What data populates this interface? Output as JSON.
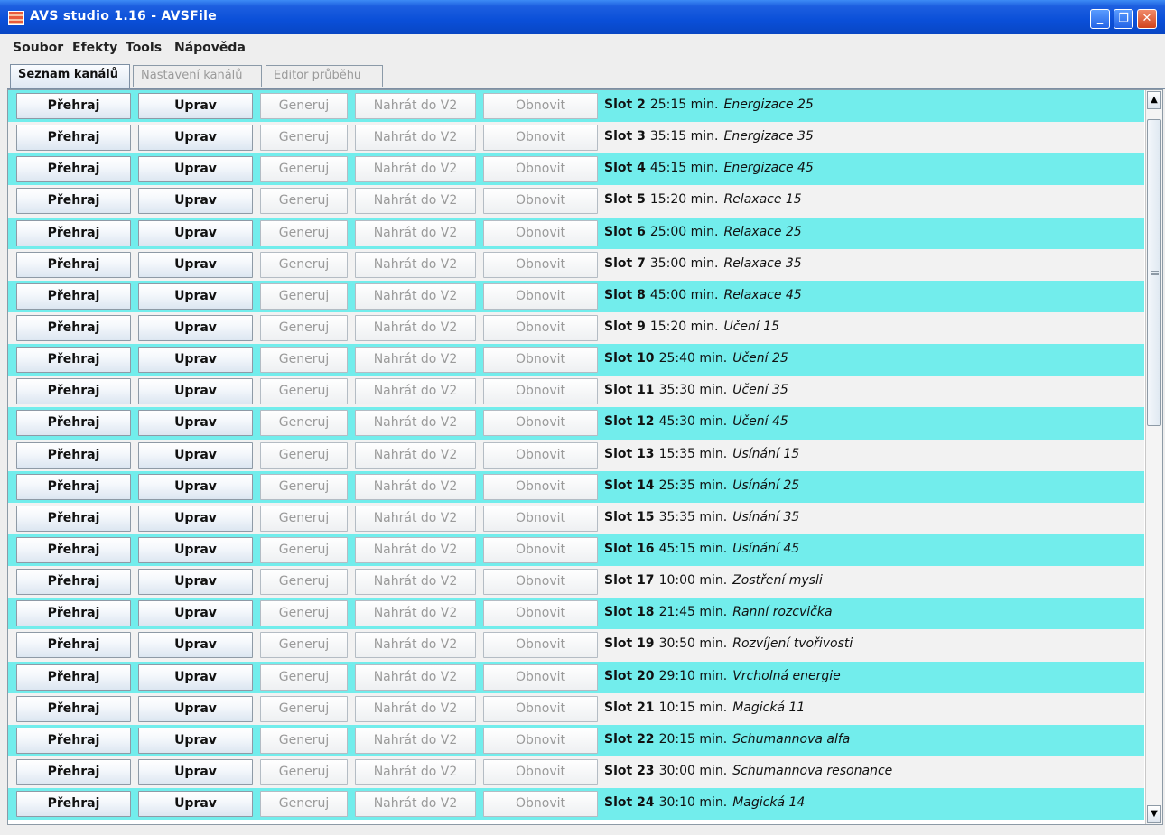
{
  "window": {
    "title": "AVS studio 1.16 - AVSFile",
    "minimize_glyph": "_",
    "maximize_glyph": "❐",
    "close_glyph": "✕"
  },
  "menu": [
    "Soubor",
    "Efekty",
    "Tools",
    "Nápověda"
  ],
  "tabs": [
    {
      "label": "Seznam kanálů",
      "active": true
    },
    {
      "label": "Nastavení kanálů",
      "active": false
    },
    {
      "label": "Editor průběhu",
      "active": false
    }
  ],
  "buttons": {
    "play": "Přehraj",
    "edit": "Uprav",
    "generate": "Generuj",
    "upload": "Nahrát do V2",
    "refresh": "Obnovit"
  },
  "rows": [
    {
      "slot": "Slot 2",
      "duration": "25:15 min.",
      "name": "Energizace 25"
    },
    {
      "slot": "Slot 3",
      "duration": "35:15 min.",
      "name": "Energizace 35"
    },
    {
      "slot": "Slot 4",
      "duration": "45:15 min.",
      "name": "Energizace 45"
    },
    {
      "slot": "Slot 5",
      "duration": "15:20 min.",
      "name": "Relaxace 15"
    },
    {
      "slot": "Slot 6",
      "duration": "25:00 min.",
      "name": "Relaxace 25"
    },
    {
      "slot": "Slot 7",
      "duration": "35:00 min.",
      "name": "Relaxace 35"
    },
    {
      "slot": "Slot 8",
      "duration": "45:00 min.",
      "name": "Relaxace 45"
    },
    {
      "slot": "Slot 9",
      "duration": "15:20 min.",
      "name": "Učení 15"
    },
    {
      "slot": "Slot 10",
      "duration": "25:40 min.",
      "name": "Učení 25"
    },
    {
      "slot": "Slot 11",
      "duration": "35:30 min.",
      "name": "Učení 35"
    },
    {
      "slot": "Slot 12",
      "duration": "45:30 min.",
      "name": "Učení 45"
    },
    {
      "slot": "Slot 13",
      "duration": "15:35 min.",
      "name": "Usínání 15"
    },
    {
      "slot": "Slot 14",
      "duration": "25:35 min.",
      "name": "Usínání 25"
    },
    {
      "slot": "Slot 15",
      "duration": "35:35 min.",
      "name": "Usínání 35"
    },
    {
      "slot": "Slot 16",
      "duration": "45:15 min.",
      "name": "Usínání 45"
    },
    {
      "slot": "Slot 17",
      "duration": "10:00 min.",
      "name": "Zostření mysli"
    },
    {
      "slot": "Slot 18",
      "duration": "21:45 min.",
      "name": "Ranní rozcvička"
    },
    {
      "slot": "Slot 19",
      "duration": "30:50 min.",
      "name": "Rozvíjení tvořivosti"
    },
    {
      "slot": "Slot 20",
      "duration": "29:10 min.",
      "name": "Vrcholná energie"
    },
    {
      "slot": "Slot 21",
      "duration": "10:15 min.",
      "name": "Magická 11"
    },
    {
      "slot": "Slot 22",
      "duration": "20:15 min.",
      "name": "Schumannova alfa"
    },
    {
      "slot": "Slot 23",
      "duration": "30:00 min.",
      "name": "Schumannova resonance"
    },
    {
      "slot": "Slot 24",
      "duration": "30:10 min.",
      "name": "Magická 14"
    }
  ],
  "colors": {
    "row_even": "#72edec",
    "row_odd": "#f2f2f2",
    "titlebar": "#0a4fd8"
  },
  "scrollbar": {
    "up_glyph": "▲",
    "down_glyph": "▼"
  }
}
